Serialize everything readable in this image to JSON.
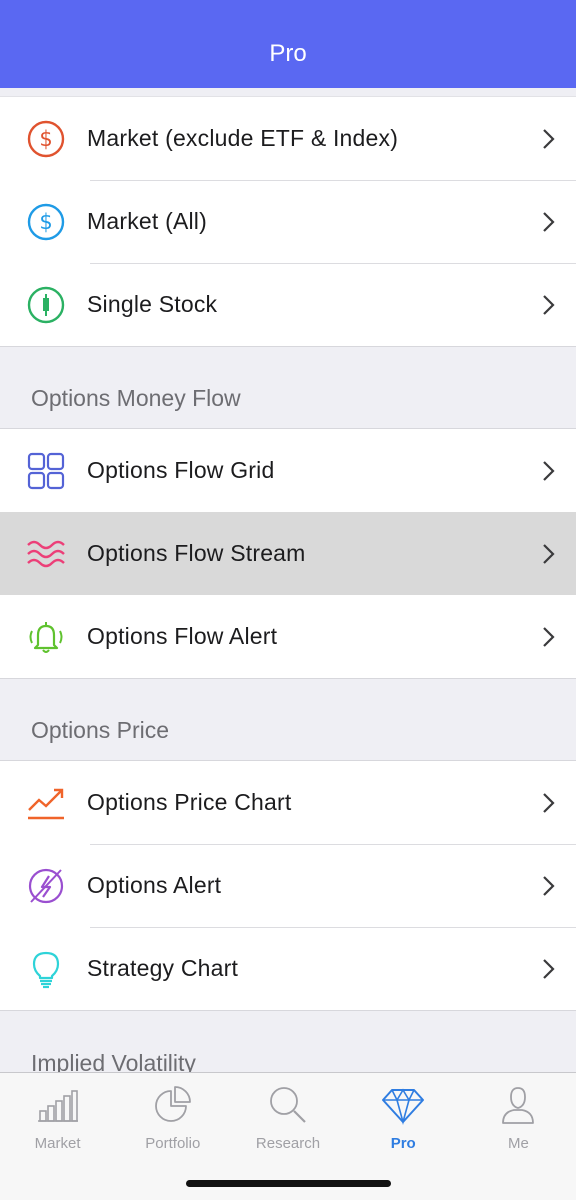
{
  "header": {
    "title": "Pro"
  },
  "groups": {
    "market": {
      "rows": [
        {
          "label": "Market (exclude ETF & Index)",
          "icon": "dollar-circle-icon",
          "color": "#e0532f"
        },
        {
          "label": "Market (All)",
          "icon": "dollar-circle-icon",
          "color": "#1f9be6"
        },
        {
          "label": "Single Stock",
          "icon": "candlestick-circle-icon",
          "color": "#2bb163"
        }
      ]
    },
    "money_flow": {
      "header": "Options Money Flow",
      "rows": [
        {
          "label": "Options Flow Grid",
          "icon": "grid-icon",
          "color": "#5463d6"
        },
        {
          "label": "Options Flow Stream",
          "icon": "waves-icon",
          "color": "#ec3f78",
          "highlighted": true
        },
        {
          "label": "Options Flow Alert",
          "icon": "bell-ringing-icon",
          "color": "#5fc22e"
        }
      ]
    },
    "price": {
      "header": "Options Price",
      "rows": [
        {
          "label": "Options Price Chart",
          "icon": "trend-up-icon",
          "color": "#f0642a"
        },
        {
          "label": "Options Alert",
          "icon": "lightning-circle-icon",
          "color": "#9a4fd0"
        },
        {
          "label": "Strategy Chart",
          "icon": "lightbulb-icon",
          "color": "#2ed3d8"
        }
      ]
    },
    "volatility": {
      "header": "Implied Volatility"
    }
  },
  "tabbar": {
    "active_color": "#2f7de1",
    "inactive_color": "#a0a0a5",
    "tabs": [
      {
        "label": "Market",
        "icon": "bar-chart-icon"
      },
      {
        "label": "Portfolio",
        "icon": "pie-chart-icon"
      },
      {
        "label": "Research",
        "icon": "search-icon"
      },
      {
        "label": "Pro",
        "icon": "diamond-icon",
        "active": true
      },
      {
        "label": "Me",
        "icon": "person-icon"
      }
    ]
  }
}
